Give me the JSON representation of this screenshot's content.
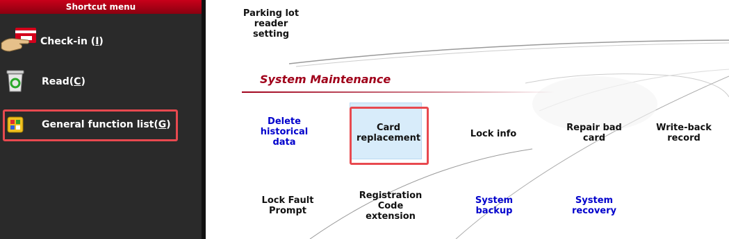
{
  "sidebar": {
    "header": "Shortcut menu",
    "items": [
      {
        "label": "Check-in (",
        "key": "I",
        "suffix": ")",
        "icon": "card-hand-icon"
      },
      {
        "label": "Read(",
        "key": "C",
        "suffix": ")",
        "icon": "recycle-bin-icon"
      },
      {
        "label": "General function list(",
        "key": "G",
        "suffix": ")",
        "icon": "function-grid-icon"
      }
    ]
  },
  "main": {
    "top_item": "Parking lot reader setting",
    "section_title": "System Maintenance",
    "row1": [
      {
        "label": "Delete historical data",
        "color": "#0000cc"
      },
      {
        "label": "Card replacement",
        "color": "#111111"
      },
      {
        "label": "Lock info",
        "color": "#111111"
      },
      {
        "label": "Repair bad card",
        "color": "#111111"
      },
      {
        "label": "Write-back record",
        "color": "#111111"
      }
    ],
    "row2": [
      {
        "label": "Lock Fault Prompt",
        "color": "#111111"
      },
      {
        "label": "Registration Code extension",
        "color": "#111111"
      },
      {
        "label": "System backup",
        "color": "#0000cc"
      },
      {
        "label": "System recovery",
        "color": "#0000cc"
      }
    ]
  },
  "colors": {
    "accent_red": "#c8001a",
    "highlight": "#e8494f",
    "link_blue": "#0000cc"
  }
}
